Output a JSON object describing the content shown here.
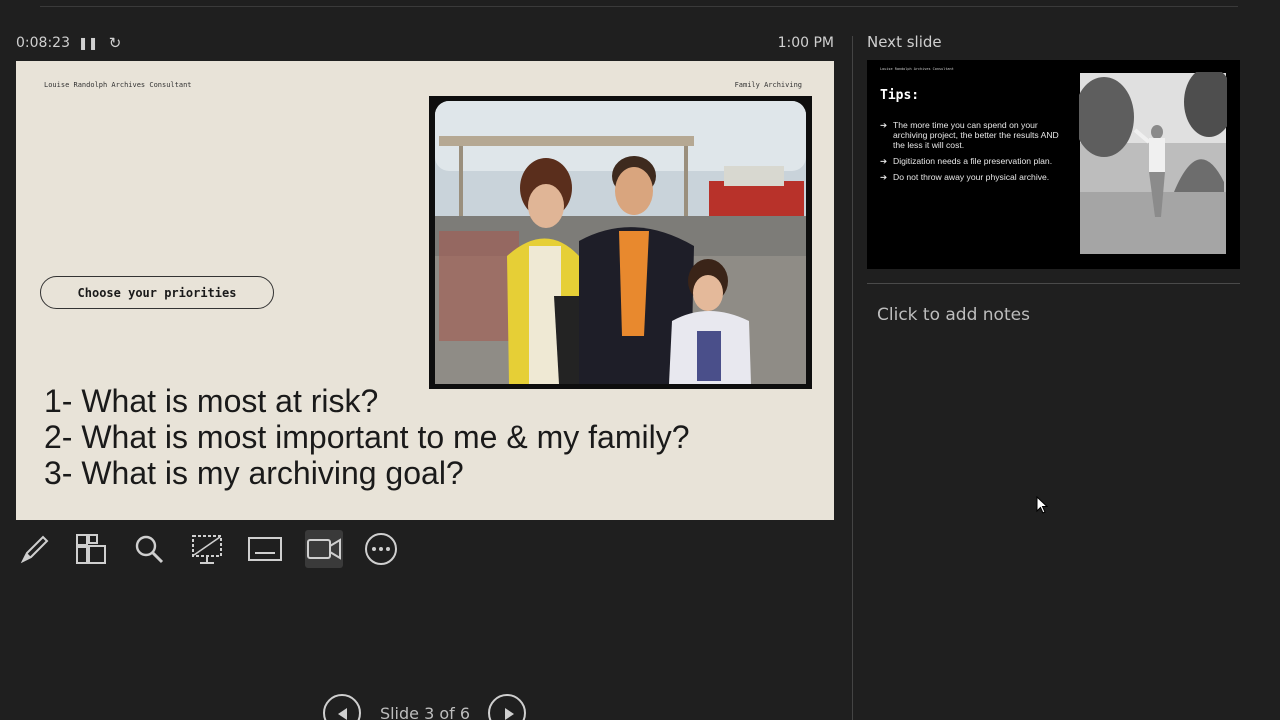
{
  "header": {
    "timer": "0:08:23",
    "clock": "1:00 PM"
  },
  "slide": {
    "author": "Louise Randolph Archives Consultant",
    "topic": "Family Archiving",
    "pill_label": "Choose your priorities",
    "questions": [
      "1- What is most at risk?",
      "2- What is most important to me & my family?",
      "3- What is my archiving goal?"
    ]
  },
  "toolbar": {
    "tools": [
      "pen-tool",
      "all-slides",
      "zoom",
      "screen",
      "subtitles",
      "camera",
      "more-options"
    ],
    "active_tool": "camera"
  },
  "navigation": {
    "counter": "Slide 3 of 6"
  },
  "next_slide": {
    "label": "Next slide",
    "author": "Louise Randolph Archives Consultant",
    "title": "Tips:",
    "tips": [
      "The more time you can spend on your archiving project, the better the results AND the less it will cost.",
      "Digitization needs a file preservation plan.",
      "Do not throw away your physical archive."
    ]
  },
  "notes": {
    "placeholder": "Click to add notes"
  },
  "colors": {
    "background": "#1f1f1f",
    "slide_background": "#e8e3d8",
    "active_tool": "#3a3a3a"
  }
}
